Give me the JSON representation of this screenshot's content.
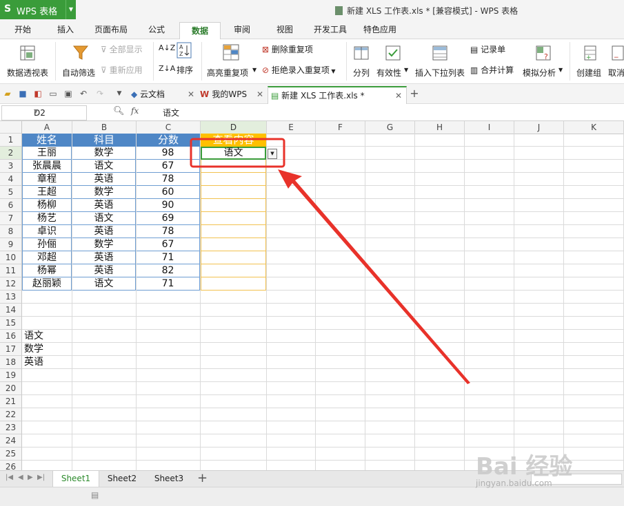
{
  "app": {
    "name": "WPS 表格",
    "window_title": "新建 XLS 工作表.xls * [兼容模式] - WPS 表格"
  },
  "ribbon_tabs": [
    "开始",
    "插入",
    "页面布局",
    "公式",
    "数据",
    "审阅",
    "视图",
    "开发工具",
    "特色应用"
  ],
  "active_ribbon_tab": "数据",
  "ribbon": {
    "pivot": "数据透视表",
    "autofilter": "自动筛选",
    "show_all": "全部显示",
    "reapply": "重新应用",
    "sort": "排序",
    "highlight_dup": "高亮重复项",
    "delete_dup": "删除重复项",
    "reject_dup": "拒绝录入重复项",
    "split": "分列",
    "validity": "有效性",
    "insert_dropdown": "插入下拉列表",
    "record_form": "记录单",
    "consolidate": "合并计算",
    "what_if": "模拟分析",
    "group": "创建组",
    "ungroup": "取消"
  },
  "doc_tabs": [
    {
      "label": "云文档",
      "icon": "cloud-icon"
    },
    {
      "label": "我的WPS",
      "icon": "wps-logo-icon"
    },
    {
      "label": "新建 XLS 工作表.xls *",
      "icon": "sheet-doc-icon"
    }
  ],
  "formula_bar": {
    "cell_ref": "D2",
    "fx": "fx",
    "content": "语文"
  },
  "columns": [
    "A",
    "B",
    "C",
    "D",
    "E",
    "F",
    "G",
    "H",
    "I",
    "J",
    "K"
  ],
  "rows": [
    "1",
    "2",
    "3",
    "4",
    "5",
    "6",
    "7",
    "8",
    "9",
    "10",
    "11",
    "12",
    "13",
    "14",
    "15",
    "16",
    "17",
    "18",
    "19",
    "20",
    "21",
    "22",
    "23",
    "24",
    "25",
    "26"
  ],
  "table": {
    "headers": [
      "姓名",
      "科目",
      "分数",
      "查看内容"
    ],
    "data": [
      [
        "王丽",
        "数学",
        "98"
      ],
      [
        "张晨晨",
        "语文",
        "67"
      ],
      [
        "章程",
        "英语",
        "78"
      ],
      [
        "王超",
        "数学",
        "60"
      ],
      [
        "杨柳",
        "英语",
        "90"
      ],
      [
        "杨艺",
        "语文",
        "69"
      ],
      [
        "卓识",
        "英语",
        "78"
      ],
      [
        "孙俪",
        "数学",
        "67"
      ],
      [
        "邓超",
        "英语",
        "71"
      ],
      [
        "杨幂",
        "英语",
        "82"
      ],
      [
        "赵丽颖",
        "语文",
        "71"
      ]
    ],
    "d2_value": "语文"
  },
  "list_values": [
    "语文",
    "数学",
    "英语"
  ],
  "sheet_tabs": [
    "Sheet1",
    "Sheet2",
    "Sheet3"
  ],
  "active_sheet": "Sheet1",
  "watermark": {
    "main": "Bai 经验",
    "url": "jingyan.baidu.com"
  },
  "colors": {
    "header_fill": "#4f87c6",
    "d1_fill": "#ffc000",
    "annotation_red": "#e8322a",
    "accent_green": "#3a9c3a"
  }
}
